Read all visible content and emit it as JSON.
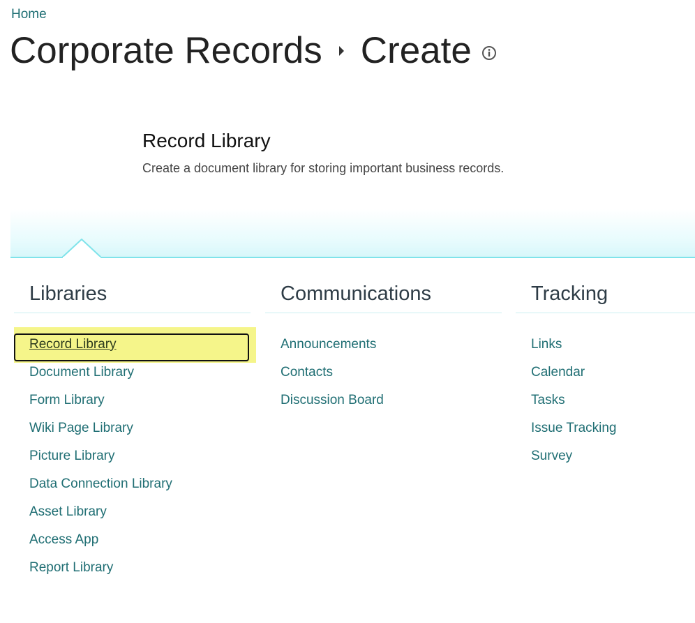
{
  "breadcrumb": {
    "home_label": "Home"
  },
  "title": {
    "site": "Corporate Records",
    "page": "Create"
  },
  "preview": {
    "title": "Record Library",
    "description": "Create a document library for storing important business records."
  },
  "columns": [
    {
      "heading": "Libraries",
      "items": [
        "Record Library",
        "Document Library",
        "Form Library",
        "Wiki Page Library",
        "Picture Library",
        "Data Connection Library",
        "Asset Library",
        "Access App",
        "Report Library"
      ]
    },
    {
      "heading": "Communications",
      "items": [
        "Announcements",
        "Contacts",
        "Discussion Board"
      ]
    },
    {
      "heading": "Tracking",
      "items": [
        "Links",
        "Calendar",
        "Tasks",
        "Issue Tracking",
        "Survey"
      ]
    }
  ],
  "selected_item": "Record Library",
  "colors": {
    "link": "#1f6e73",
    "highlight": "#f5f58a",
    "band_line": "#7fe3ea"
  }
}
